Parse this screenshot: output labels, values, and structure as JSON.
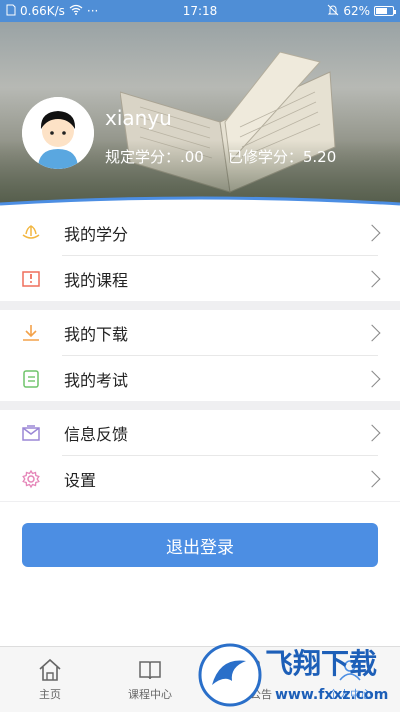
{
  "status_bar": {
    "network_speed": "0.66K/s",
    "more": "···",
    "time": "17:18",
    "battery": "62%"
  },
  "profile": {
    "username": "xianyu",
    "required_credits": "规定学分：.00",
    "earned_credits": "已修学分：5.20"
  },
  "menu_groups": [
    [
      {
        "label": "我的学分",
        "icon": "lotus-icon",
        "color": "#f2b640"
      },
      {
        "label": "我的课程",
        "icon": "book-icon",
        "color": "#ef6f5c"
      }
    ],
    [
      {
        "label": "我的下载",
        "icon": "download-icon",
        "color": "#f3a24a"
      },
      {
        "label": "我的考试",
        "icon": "exam-icon",
        "color": "#6fc46a"
      }
    ],
    [
      {
        "label": "信息反馈",
        "icon": "mail-icon",
        "color": "#9b87d6"
      },
      {
        "label": "设置",
        "icon": "gear-icon",
        "color": "#e585b8"
      }
    ]
  ],
  "logout_button": "退出登录",
  "tabs": [
    {
      "label": "主页",
      "icon": "home-icon"
    },
    {
      "label": "课程中心",
      "icon": "course-book-icon"
    },
    {
      "label": "通知公告",
      "icon": "notice-icon"
    },
    {
      "label": "个人中心",
      "icon": "person-icon",
      "active": true
    }
  ],
  "watermark": {
    "title": "飞翔下载",
    "url": "www.fxxz.com"
  },
  "colors": {
    "accent": "#4c8ee3",
    "status_bar": "#4f8ed6"
  }
}
